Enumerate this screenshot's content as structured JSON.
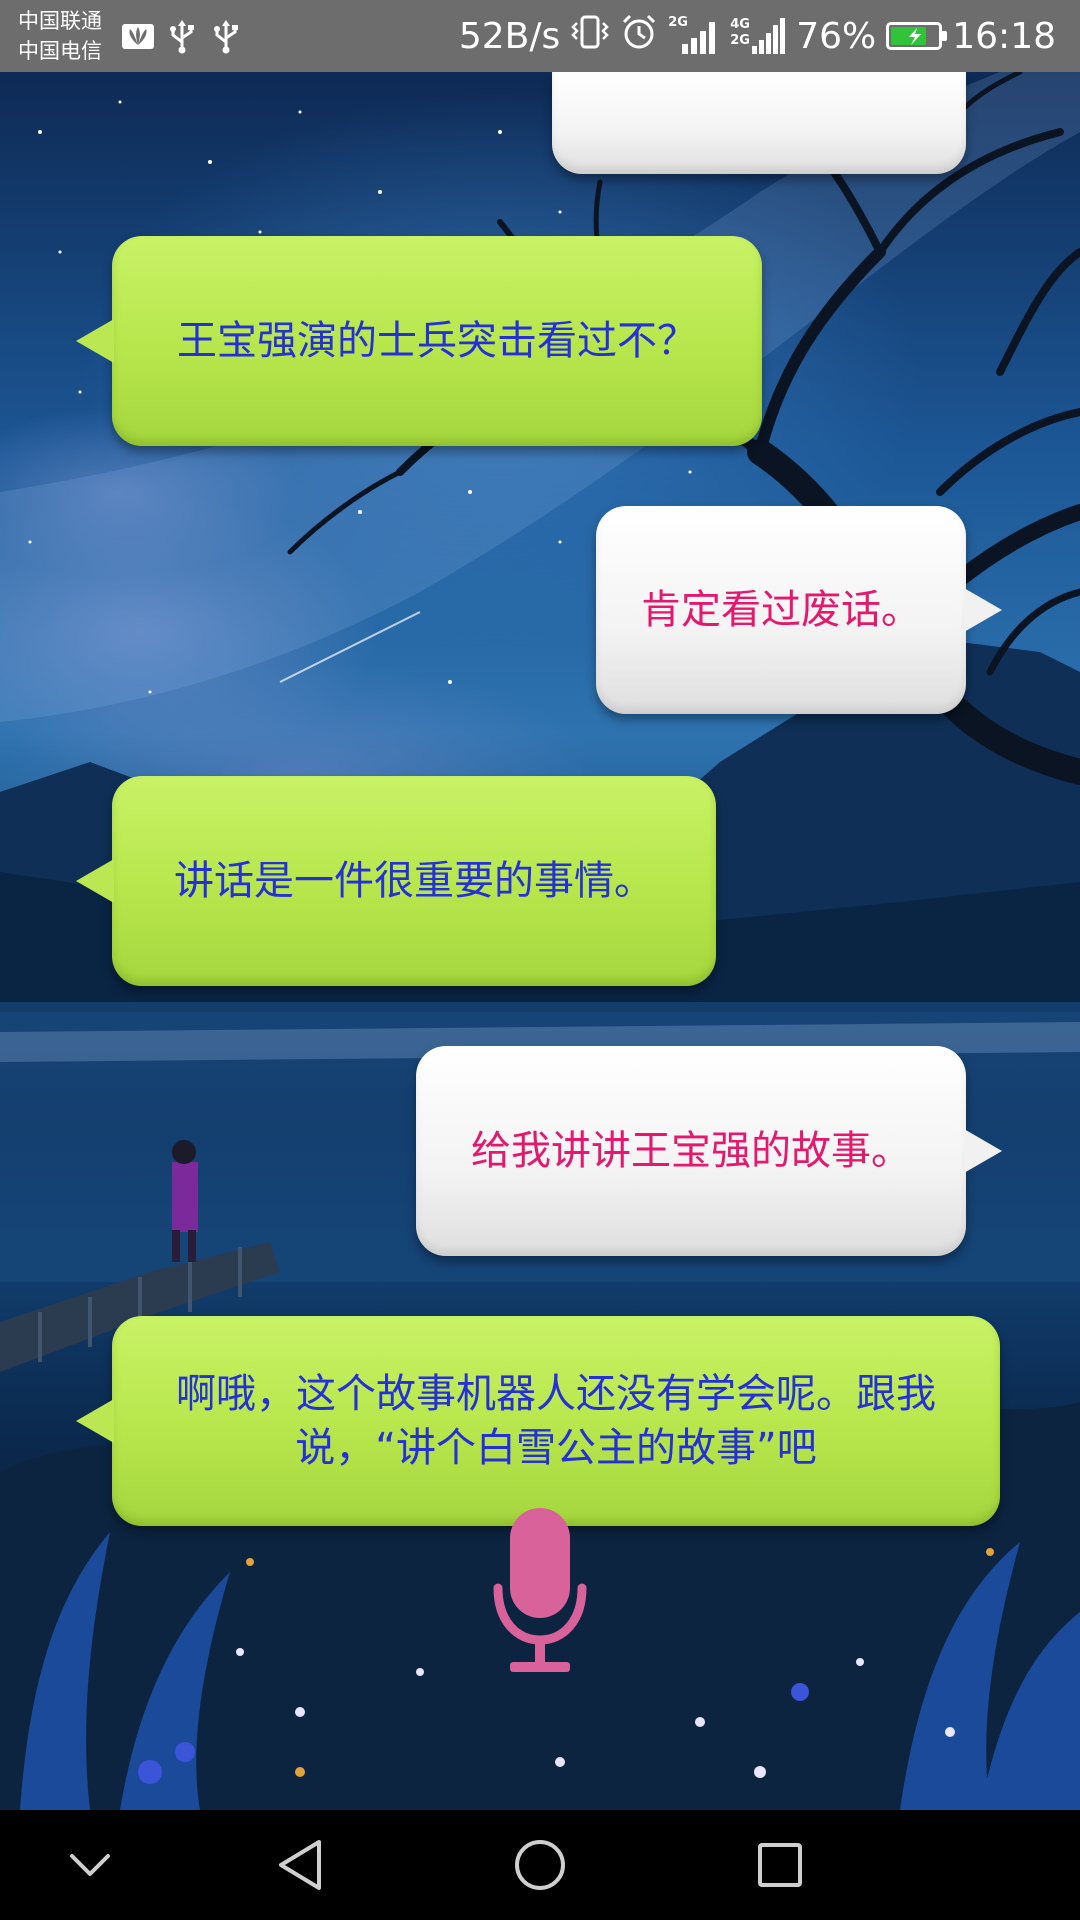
{
  "status_bar": {
    "carrier_1": "中国联通",
    "carrier_2": "中国电信",
    "network_speed": "52B/s",
    "signal_1_label": "2G",
    "signal_2_label": "4G",
    "signal_2_sub": "2G",
    "battery_percent": "76%",
    "battery_level": 0.76,
    "time": "16:18",
    "icons": [
      "huawei-icon",
      "usb-icon",
      "usb-icon",
      "vibrate-icon",
      "alarm-icon",
      "signal-icon",
      "signal-icon",
      "battery-charging-icon"
    ]
  },
  "chat": {
    "messages": [
      {
        "role": "user",
        "text": ""
      },
      {
        "role": "bot",
        "text": "王宝强演的士兵突击看过不？"
      },
      {
        "role": "user",
        "text": "肯定看过废话。"
      },
      {
        "role": "bot",
        "text": "讲话是一件很重要的事情。"
      },
      {
        "role": "user",
        "text": "给我讲讲王宝强的故事。"
      },
      {
        "role": "bot",
        "text": "啊哦，这个故事机器人还没有学会呢。跟我说，“讲个白雪公主的故事”吧"
      }
    ]
  },
  "mic": {
    "icon": "microphone-icon",
    "color": "#d9629b"
  },
  "nav_bar": {
    "buttons": [
      "collapse-icon",
      "back-icon",
      "home-icon",
      "recents-icon"
    ]
  },
  "colors": {
    "bot_bubble": "#b6e64b",
    "bot_text": "#2531d6",
    "user_bubble": "#f3f3f3",
    "user_text": "#e4196e",
    "status_bar": "#6d6d6d",
    "battery_fill": "#31c43a"
  }
}
